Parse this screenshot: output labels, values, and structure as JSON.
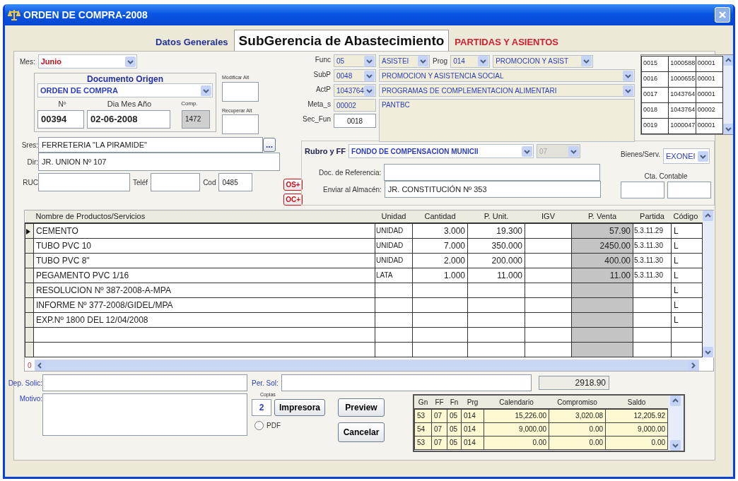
{
  "window": {
    "title": "ORDEN DE COMPRA-2008"
  },
  "tabs": [
    {
      "label": "Datos Generales",
      "selected": false,
      "color": "#22309a"
    },
    {
      "label": "SubGerencia de Abastecimiento",
      "selected": true,
      "color": "#111111"
    },
    {
      "label": "PARTIDAS Y ASIENTOS",
      "selected": false,
      "color": "#d0202e"
    }
  ],
  "mes": {
    "label": "Mes:",
    "value": "Junio"
  },
  "documento_origen": {
    "title": "Documento Origen",
    "tipo": "ORDEN DE COMPRA",
    "numero_label": "Nº",
    "fecha_label": "Dia Mes Año",
    "comp_label": "Comp.",
    "numero": "00394",
    "fecha": "02-06-2008",
    "comp": "1472"
  },
  "alt_labels": [
    "Modificar Alt",
    "Recuperar Alt"
  ],
  "proveedor": {
    "sres_label": "Sres:",
    "sres": "FERRETERIA \"LA PIRAMIDE\"",
    "browse": "...",
    "dir_label": "Dir:",
    "dir": "JR. UNION Nº 107",
    "ruc_label": "RUC",
    "telef_label": "Teléf",
    "cod_label": "Cod",
    "cod": "0485"
  },
  "order_buttons": [
    "OS+",
    "OC+"
  ],
  "clasificador": [
    {
      "kind": "combo",
      "label": "Func",
      "code": "05",
      "desc": "ASISTEI",
      "prog_label": "Prog",
      "prog": "014",
      "prog_desc": "PROMOCION Y  ASIST"
    },
    {
      "kind": "combo",
      "label": "SubP",
      "code": "0048",
      "desc": "PROMOCION Y ASISTENCIA SOCIAL"
    },
    {
      "kind": "combo",
      "label": "ActP",
      "code": "1043764",
      "desc": "PROGRAMAS DE COMPLEMENTACION ALIMENTARI"
    },
    {
      "kind": "text",
      "label": "Meta_s",
      "code": "00002",
      "desc": "PANTBC"
    },
    {
      "kind": "field",
      "label": "Sec_Fun",
      "code": "0018"
    }
  ],
  "metas": [
    [
      "0015",
      "1000588",
      "00001"
    ],
    [
      "0016",
      "1000655",
      "00001"
    ],
    [
      "0017",
      "1043764",
      "00001"
    ],
    [
      "0018",
      "1043764",
      "00002"
    ],
    [
      "0019",
      "1000047",
      "00001"
    ]
  ],
  "rubro": {
    "label": "Rubro y FF",
    "value": "FONDO DE COMPENSACION MUNICII",
    "code": "07",
    "code_disabled": true
  },
  "bienes": {
    "label": "Bienes/Serv.",
    "value": "EXONEI"
  },
  "doc_ref": {
    "label": "Doc. de Referencia:"
  },
  "almacen": {
    "label": "Enviar al Almacén:",
    "value": "JR. CONSTITUCIÓN Nº 353"
  },
  "cta_contable": {
    "label": "Cta. Contable"
  },
  "items_table": {
    "columns": [
      "Nombre de  Productos/Servicios",
      "Unidad",
      "Cantidad",
      "P. Unit.",
      "IGV",
      "P. Venta",
      "Partida",
      "Código"
    ],
    "rows": [
      {
        "selected": true,
        "name": "CEMENTO",
        "unidad": "UNIDAD",
        "cantidad": "3.000",
        "p_unit": "19.300",
        "p_venta": "57.90",
        "partida": "5.3.11.29",
        "codigo": "L"
      },
      {
        "selected": false,
        "name": "TUBO PVC 10",
        "unidad": "UNIDAD",
        "cantidad": "7.000",
        "p_unit": "350.000",
        "p_venta": "2450.00",
        "partida": "5.3.11.30",
        "codigo": "L"
      },
      {
        "selected": false,
        "name": "TUBO PVC 8\"",
        "unidad": "UNIDAD",
        "cantidad": "2.000",
        "p_unit": "200.000",
        "p_venta": "400.00",
        "partida": "5.3.11.30",
        "codigo": "L"
      },
      {
        "selected": false,
        "name": "PEGAMENTO PVC 1/16",
        "unidad": "LATA",
        "cantidad": "1.000",
        "p_unit": "11.000",
        "p_venta": "11.00",
        "partida": "5.3.11.30",
        "codigo": "L"
      },
      {
        "selected": false,
        "name": "RESOLUCION Nº 387-2008-A-MPA",
        "codigo": "L"
      },
      {
        "selected": false,
        "name": "INFORME Nº 377-2008/GIDEL/MPA",
        "codigo": "L"
      },
      {
        "selected": false,
        "name": "EXP.Nº 1800 DEL 12/04/2008",
        "codigo": "L"
      },
      {
        "selected": false
      },
      {
        "selected": false
      }
    ],
    "counter": "0"
  },
  "footer": {
    "dep_label": "Dep. Solic:",
    "per_label": "Per. Sol:",
    "total": "2918.90",
    "motivo_label": "Motivo:",
    "copias_label": "Copias",
    "copias": "2",
    "print_button": "Impresora",
    "pdf": {
      "label": "PDF",
      "checked": false
    },
    "preview_button": "Preview",
    "cancel_button": "Cancelar"
  },
  "budget_table": {
    "columns": [
      "Gn",
      "FF",
      "Fn",
      "Prg",
      "Calendario",
      "Compromiso",
      "Saldo"
    ],
    "rows": [
      [
        "53",
        "07",
        "05",
        "014",
        "15,226.00",
        "3,020.08",
        "12,205.92"
      ],
      [
        "54",
        "07",
        "05",
        "014",
        "9,000.00",
        "0.00",
        "9,000.00"
      ],
      [
        "53",
        "07",
        "05",
        "014",
        "0.00",
        "0.00",
        "0.00"
      ]
    ]
  }
}
